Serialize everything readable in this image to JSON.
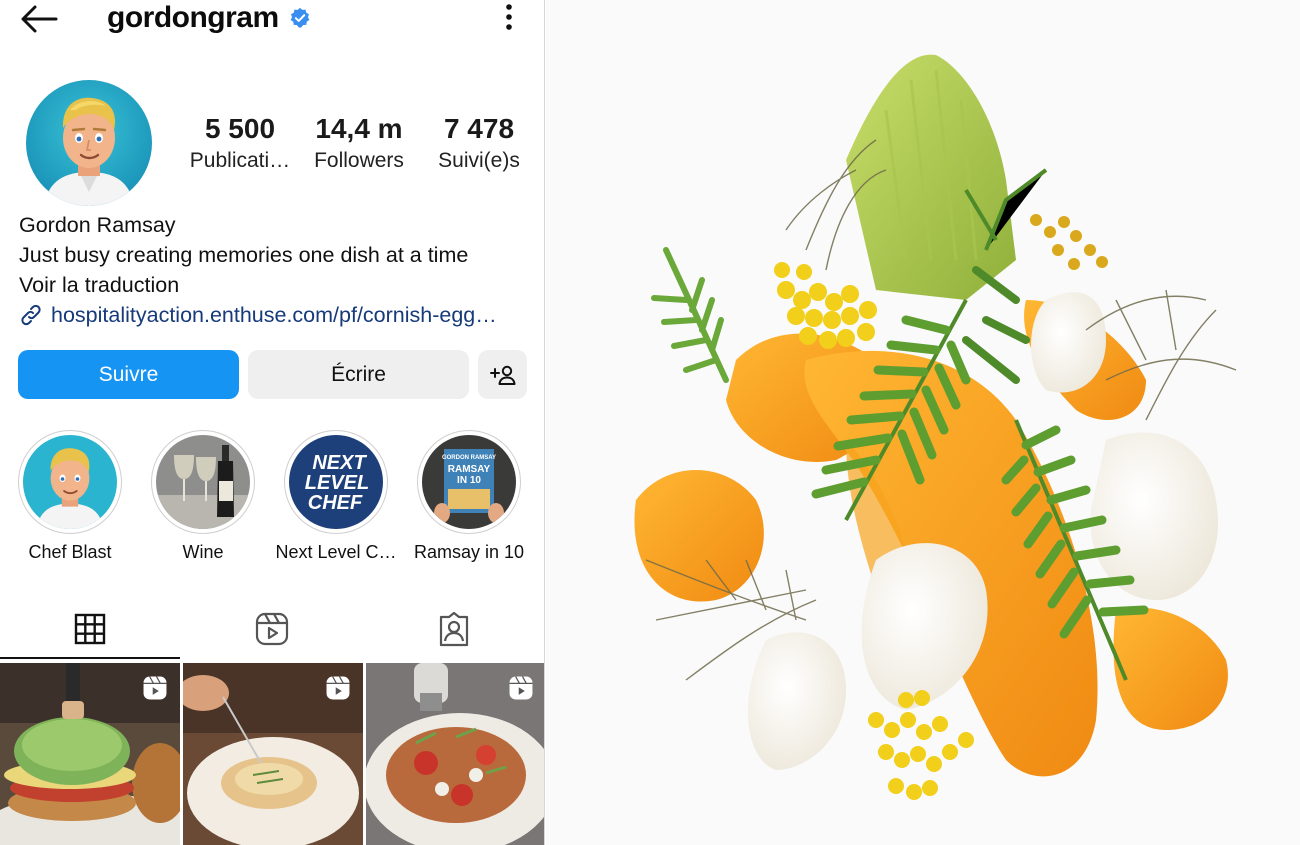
{
  "header": {
    "username": "gordongram",
    "back_icon": "back-arrow-icon",
    "more_icon": "more-vertical-icon",
    "verified_icon": "verified-badge-icon"
  },
  "stats": {
    "posts": {
      "value": "5 500",
      "label": "Publicati…"
    },
    "followers": {
      "value": "14,4 m",
      "label": "Followers"
    },
    "following": {
      "value": "7 478",
      "label": "Suivi(e)s"
    }
  },
  "bio": {
    "name": "Gordon Ramsay",
    "text": "Just busy creating memories one dish at a time",
    "translate": "Voir la traduction",
    "link": "hospitalityaction.enthuse.com/pf/cornish-egg…"
  },
  "actions": {
    "follow": "Suivre",
    "message": "Écrire",
    "suggest_icon": "add-person-icon"
  },
  "highlights": [
    {
      "label": "Chef Blast"
    },
    {
      "label": "Wine"
    },
    {
      "label": "Next Level C…"
    },
    {
      "label": "Ramsay in 10"
    }
  ],
  "highlight_texts": {
    "nlc_line1": "NEXT",
    "nlc_line2": "LEVEL",
    "nlc_line3": "CHEF",
    "book_author": "GORDON RAMSAY",
    "book_title1": "RAMSAY",
    "book_title2": "IN 10"
  },
  "tabs": [
    {
      "icon": "grid-icon",
      "selected": true
    },
    {
      "icon": "reels-icon",
      "selected": false
    },
    {
      "icon": "tagged-icon",
      "selected": false
    }
  ],
  "colors": {
    "accent": "#1694f3",
    "verified": "#3a8ef0",
    "link": "#163a7a"
  }
}
